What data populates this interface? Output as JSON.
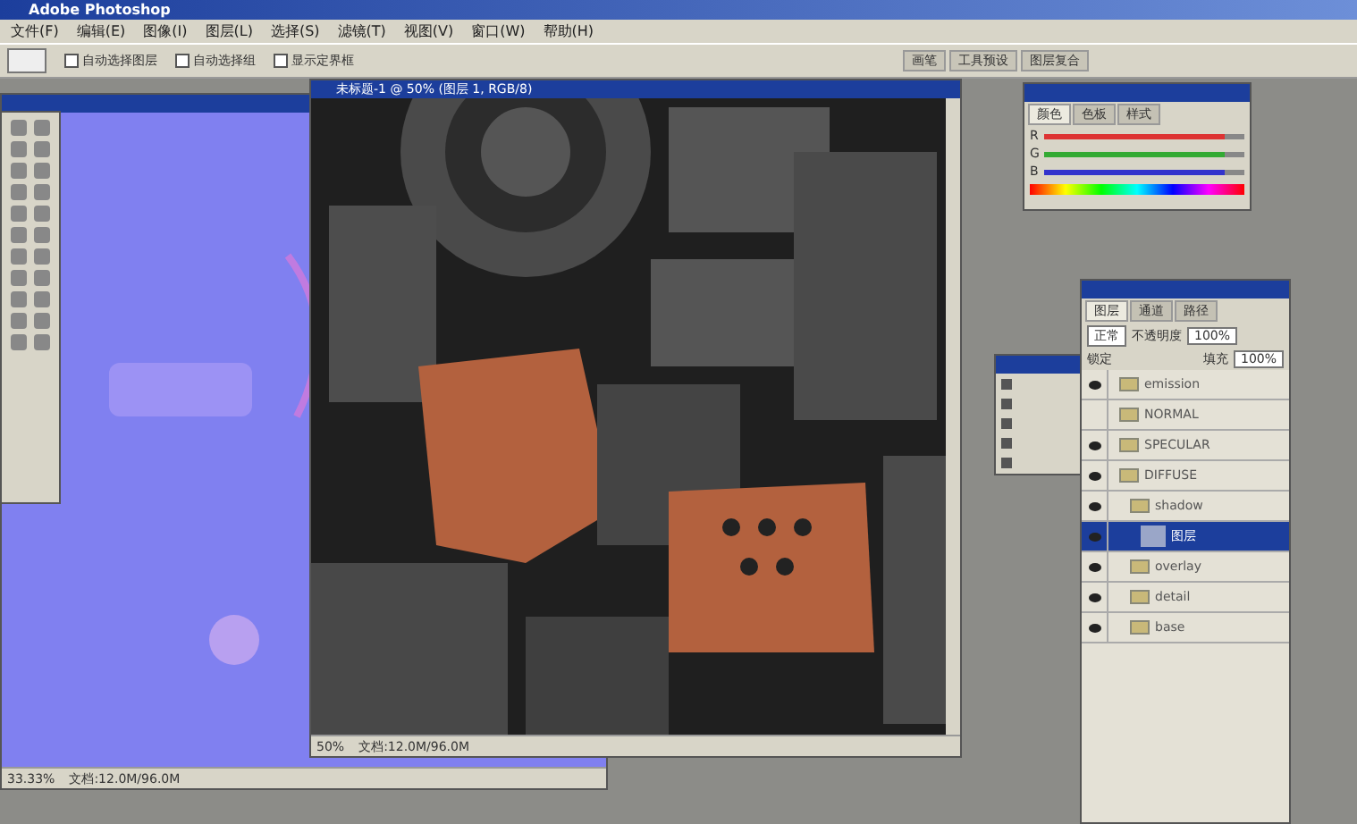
{
  "window": {
    "title": "Adobe Photoshop"
  },
  "menu": [
    "文件(F)",
    "编辑(E)",
    "图像(I)",
    "图层(L)",
    "选择(S)",
    "滤镜(T)",
    "视图(V)",
    "窗口(W)",
    "帮助(H)"
  ],
  "options_bar": {
    "checkboxes": [
      {
        "label": "自动选择图层",
        "checked": false
      },
      {
        "label": "自动选择组",
        "checked": false
      },
      {
        "label": "显示定界框",
        "checked": false
      }
    ]
  },
  "palette_well": [
    "画笔",
    "工具预设",
    "图层复合"
  ],
  "documents": [
    {
      "kind": "normal",
      "zoom": "33.33%",
      "info": "文档:12.0M/96.0M"
    },
    {
      "kind": "texture",
      "title": "未标题-1 @ 50% (图层 1, RGB/8)",
      "zoom": "50%",
      "info": "文档:12.0M/96.0M"
    }
  ],
  "color_palette": {
    "tabs": [
      {
        "label": "颜色",
        "selected": true
      },
      {
        "label": "色板",
        "selected": false
      },
      {
        "label": "样式",
        "selected": false
      }
    ],
    "channels": [
      {
        "name": "R",
        "level": 0.9
      },
      {
        "name": "G",
        "level": 0.9
      },
      {
        "name": "B",
        "level": 0.9
      }
    ]
  },
  "layers_palette": {
    "tabs": [
      {
        "label": "图层",
        "selected": true
      },
      {
        "label": "通道",
        "selected": false
      },
      {
        "label": "路径",
        "selected": false
      }
    ],
    "blend_mode": "正常",
    "opacity_label": "不透明度",
    "opacity": "100%",
    "lock_label": "锁定",
    "fill_label": "填充",
    "fill": "100%",
    "layers": [
      {
        "kind": "group",
        "name": "emission",
        "visible": true,
        "selected": false
      },
      {
        "kind": "group",
        "name": "NORMAL",
        "visible": false,
        "selected": false
      },
      {
        "kind": "group",
        "name": "SPECULAR",
        "visible": true,
        "selected": false
      },
      {
        "kind": "group",
        "name": "DIFFUSE",
        "visible": true,
        "selected": false,
        "children": [
          {
            "kind": "group",
            "name": "shadow",
            "visible": true,
            "selected": false,
            "children": [
              {
                "kind": "layer",
                "name": "图层",
                "visible": true,
                "selected": true
              }
            ]
          },
          {
            "kind": "group",
            "name": "overlay",
            "visible": true,
            "selected": false
          },
          {
            "kind": "group",
            "name": "detail",
            "visible": true,
            "selected": false
          },
          {
            "kind": "group",
            "name": "base",
            "visible": true,
            "selected": false
          }
        ]
      }
    ]
  }
}
